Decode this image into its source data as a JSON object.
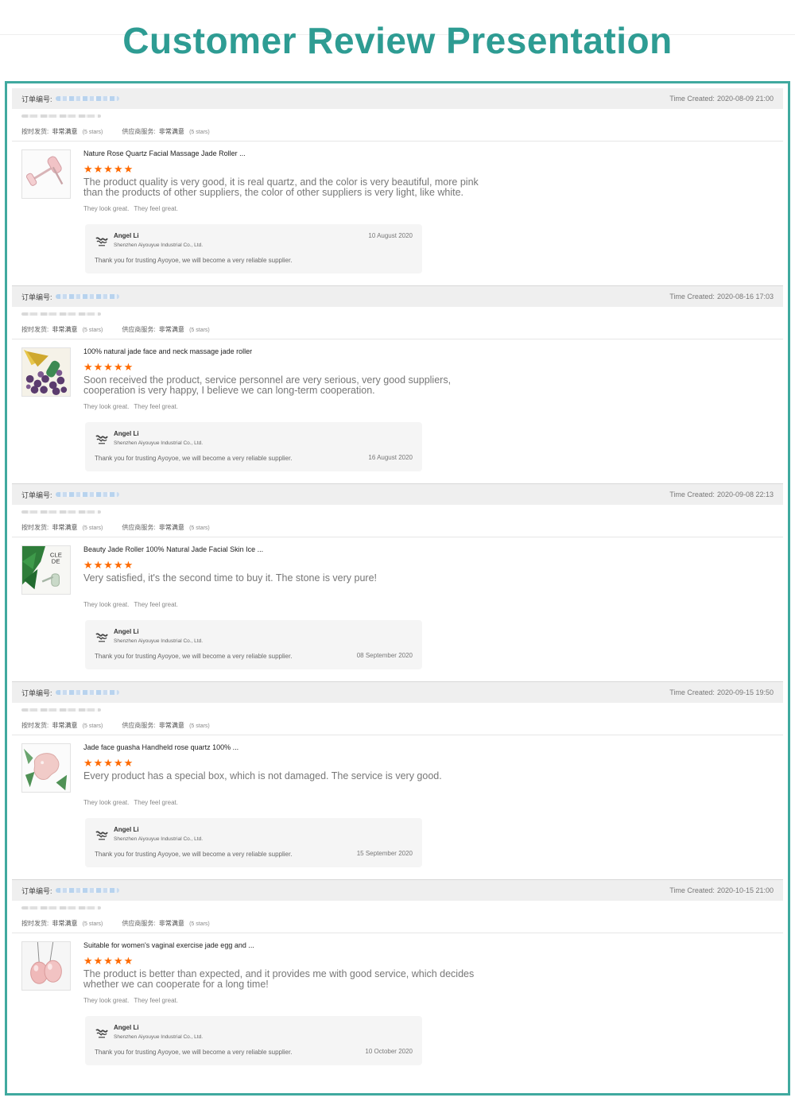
{
  "page": {
    "title": "Customer Review Presentation"
  },
  "common": {
    "order_label": "订单编号:",
    "time_label": "Time Created:",
    "ontime_label": "按时发货:",
    "service_label": "供应商服务:",
    "rating_value": "非常满意",
    "rating_stars_text": "(5 stars)",
    "stars": "★★★★★",
    "tag1": "They look great.",
    "tag2": "They feel great.",
    "reply_name": "Angel Li",
    "reply_company": "Shenzhen Aiyouyue Industrial Co., Ltd.",
    "reply_text": "Thank you for trusting Ayoyoe, we will become a very reliable supplier."
  },
  "reviews": [
    {
      "time": "2020-08-09 21:00",
      "product": "Nature Rose Quartz Facial Massage Jade Roller ...",
      "comment": "The product quality is very good, it is real quartz, and the color is very beautiful, more pink than the products of other suppliers, the color of other suppliers is very light, like white.",
      "reply_date": "10 August 2020",
      "date_pos": "top",
      "thumb": "rose-quartz-roller"
    },
    {
      "time": "2020-08-16 17:03",
      "product": "100% natural jade face and neck massage jade roller",
      "comment": "Soon received the product, service personnel are very serious, very good suppliers, cooperation is very happy, I believe we can long-term cooperation.",
      "reply_date": "16 August 2020",
      "date_pos": "bottom",
      "thumb": "amethyst-roller"
    },
    {
      "time": "2020-09-08 22:13",
      "product": "Beauty Jade Roller 100% Natural Jade Facial Skin Ice ...",
      "comment": "Very satisfied, it's the second time to buy it. The stone is very pure!",
      "reply_date": "08 September 2020",
      "date_pos": "bottom",
      "thumb": "green-leaf-roller"
    },
    {
      "time": "2020-09-15 19:50",
      "product": "Jade face guasha Handheld rose quartz 100% ...",
      "comment": "Every product has a special box, which is not damaged. The service is very good.",
      "reply_date": "15 September 2020",
      "date_pos": "bottom",
      "thumb": "rose-quartz-guasha"
    },
    {
      "time": "2020-10-15 21:00",
      "product": "Suitable for women's vaginal exercise jade egg and ...",
      "comment": "The product is better than expected, and it provides me with good service, which decides whether we can cooperate for a long time!",
      "reply_date": "10 October 2020",
      "date_pos": "bottom",
      "thumb": "jade-eggs"
    }
  ]
}
